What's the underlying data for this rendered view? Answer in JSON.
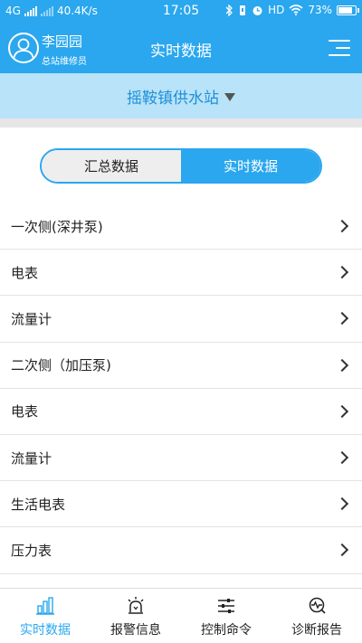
{
  "status_bar": {
    "network": "4G",
    "speed": "40.4K/s",
    "time": "17:05",
    "hd": "HD",
    "battery": "73%"
  },
  "header": {
    "user_name": "李园园",
    "user_role": "总站维修员",
    "title": "实时数据"
  },
  "station": {
    "name": "摇鞍镇供水站"
  },
  "segment": {
    "left_label": "汇总数据",
    "right_label": "实时数据",
    "active": "right"
  },
  "list": {
    "items": [
      {
        "label": "一次侧(深井泵)"
      },
      {
        "label": "电表"
      },
      {
        "label": "流量计"
      },
      {
        "label": "二次侧（加压泵)"
      },
      {
        "label": "电表"
      },
      {
        "label": "流量计"
      },
      {
        "label": "生活电表"
      },
      {
        "label": "压力表"
      }
    ]
  },
  "bottom_nav": {
    "items": [
      {
        "label": "实时数据",
        "icon": "bar-chart-icon",
        "active": true
      },
      {
        "label": "报警信息",
        "icon": "alarm-light-icon",
        "active": false
      },
      {
        "label": "控制命令",
        "icon": "sliders-icon",
        "active": false
      },
      {
        "label": "诊断报告",
        "icon": "diagnosis-icon",
        "active": false
      }
    ]
  },
  "colors": {
    "primary": "#2aa7ee",
    "station_bar": "#b8e3f8",
    "station_text": "#1e90d8"
  }
}
